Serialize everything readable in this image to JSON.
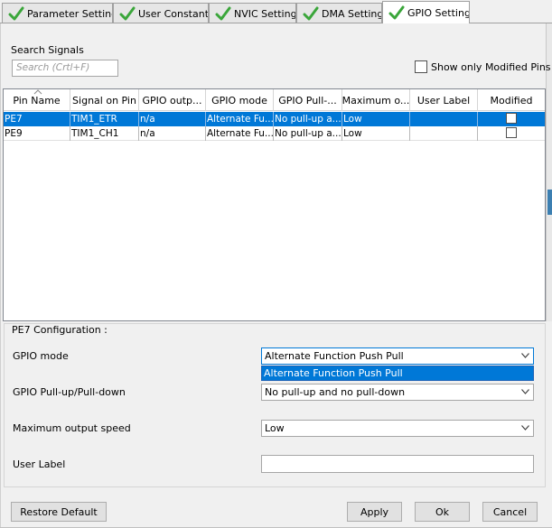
{
  "tabs": [
    {
      "label": "Parameter Settings",
      "active": false
    },
    {
      "label": "User Constants",
      "active": false
    },
    {
      "label": "NVIC Settings",
      "active": false
    },
    {
      "label": "DMA Settings",
      "active": false
    },
    {
      "label": "GPIO Settings",
      "active": true
    }
  ],
  "search": {
    "label": "Search Signals",
    "placeholder": "Search (Crtl+F)"
  },
  "show_modified": {
    "label": "Show only Modified Pins",
    "checked": false
  },
  "table": {
    "columns": [
      "Pin Name",
      "Signal on Pin",
      "GPIO outp...",
      "GPIO mode",
      "GPIO Pull-...",
      "Maximum o...",
      "User Label",
      "Modified"
    ],
    "rows": [
      {
        "pin": "PE7",
        "signal": "TIM1_ETR",
        "output": "n/a",
        "mode": "Alternate Fu...",
        "pull": "No pull-up a...",
        "speed": "Low",
        "user_label": "",
        "modified": false,
        "selected": true
      },
      {
        "pin": "PE9",
        "signal": "TIM1_CH1",
        "output": "n/a",
        "mode": "Alternate Fu...",
        "pull": "No pull-up a...",
        "speed": "Low",
        "user_label": "",
        "modified": false,
        "selected": false
      }
    ]
  },
  "config": {
    "title": "PE7 Configuration :",
    "gpio_mode": {
      "label": "GPIO mode",
      "value": "Alternate Function Push Pull",
      "open_option": "Alternate Function Push Pull"
    },
    "pull": {
      "label": "GPIO Pull-up/Pull-down",
      "value": "No pull-up and no pull-down"
    },
    "speed": {
      "label": "Maximum output speed",
      "value": "Low"
    },
    "user_label": {
      "label": "User Label",
      "value": ""
    }
  },
  "buttons": {
    "restore": "Restore Default",
    "apply": "Apply",
    "ok": "Ok",
    "cancel": "Cancel"
  },
  "colors": {
    "selection": "#0078d7",
    "check_green": "#3aa63a"
  }
}
